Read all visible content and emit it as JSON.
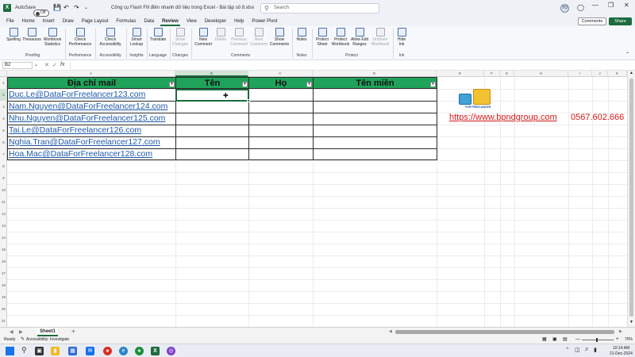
{
  "titlebar": {
    "autosave_label": "AutoSave",
    "autosave_state": "Off",
    "doc_title": "Công cụ Flash Fill điền nhanh dữ liệu trong Excel - Bài tập số 8.xlsx",
    "search_placeholder": "Search",
    "user_initials": "TO"
  },
  "menu_tabs": [
    "File",
    "Home",
    "Insert",
    "Draw",
    "Page Layout",
    "Formulas",
    "Data",
    "Review",
    "View",
    "Developer",
    "Help",
    "Power Pivot"
  ],
  "active_tab": "Review",
  "comments_btn": "Comments",
  "share_btn": "Share",
  "ribbon": {
    "groups": [
      {
        "label": "Proofing",
        "buttons": [
          "Spelling",
          "Thesaurus",
          "Workbook Statistics"
        ]
      },
      {
        "label": "Performance",
        "buttons": [
          "Check Performance"
        ]
      },
      {
        "label": "Accessibility",
        "buttons": [
          "Check Accessibility"
        ]
      },
      {
        "label": "Insights",
        "buttons": [
          "Smart Lookup"
        ]
      },
      {
        "label": "Language",
        "buttons": [
          "Translate"
        ]
      },
      {
        "label": "Changes",
        "buttons": [
          "Show Changes"
        ]
      },
      {
        "label": "Comments",
        "buttons": [
          "New Comment",
          "Delete",
          "Previous Comment",
          "Next Comment",
          "Show Comments"
        ]
      },
      {
        "label": "Notes",
        "buttons": [
          "Notes"
        ]
      },
      {
        "label": "Protect",
        "buttons": [
          "Protect Sheet",
          "Protect Workbook",
          "Allow Edit Ranges",
          "Unshare Workbook"
        ]
      },
      {
        "label": "Ink",
        "buttons": [
          "Hide Ink"
        ]
      }
    ]
  },
  "formula": {
    "name_box": "B2",
    "fx": "fx"
  },
  "columns": [
    "A",
    "B",
    "C",
    "D",
    "E",
    "F",
    "G",
    "H",
    "I",
    "J",
    "K"
  ],
  "rows": [
    "1",
    "2",
    "3",
    "4",
    "5",
    "6",
    "7",
    "8",
    "9",
    "10",
    "11",
    "12",
    "13",
    "14",
    "15",
    "16",
    "17",
    "18",
    "19",
    "20",
    "21"
  ],
  "table": {
    "headers": [
      "Địa chỉ mail",
      "Tên",
      "Họ",
      "Tên miền"
    ],
    "emails": [
      "Duc.Le@DataForFreelancer123.com",
      "Nam.Nguyen@DataForFreelancer124.com",
      "Nhu.Nguyen@DataForFreelancer125.com",
      "Tai.Le@DataForFreelancer126.com",
      "Nghia.Tran@DataForFreelancer127.com",
      "Hoa.Mac@DataForFreelancer128.com"
    ]
  },
  "promo": {
    "url": "https://www.bpndgroup.com",
    "phone": "0567.602.666",
    "logo_text": "FOR FREELANCER"
  },
  "sheets": {
    "active": "Sheet1",
    "add": "+"
  },
  "status": {
    "ready": "Ready",
    "accessibility": "Accessibility: Investigate",
    "zoom": "70%"
  },
  "taskbar": {
    "time": "10:14 AM",
    "date": "21-Dec-2024"
  },
  "colors": {
    "excel_green": "#1d6b3e",
    "header_green": "#1fa35a",
    "link_blue": "#1e5aa8",
    "promo_red": "#d21919"
  }
}
